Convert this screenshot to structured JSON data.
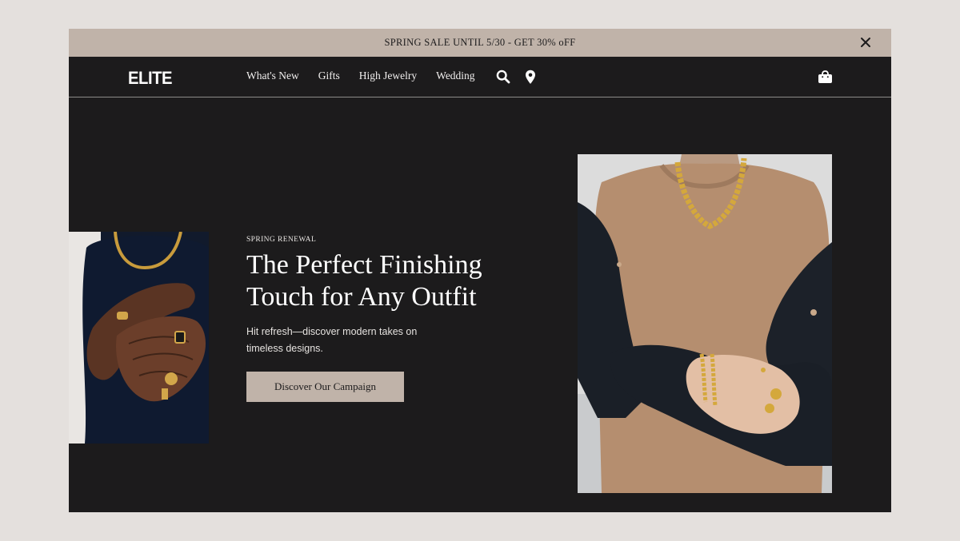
{
  "promo": {
    "text": "SPRING SALE UNTIL 5/30 - GET 30% oFF",
    "close_icon": "close-icon"
  },
  "nav": {
    "logo": "ELITE",
    "links": [
      "What's New",
      "Gifts",
      "High Jewelry",
      "Wedding"
    ],
    "icons": [
      "search-icon",
      "location-pin-icon",
      "shopping-bag-icon"
    ]
  },
  "hero": {
    "eyebrow": "SPRING RENEWAL",
    "headline": "The Perfect Finishing Touch for Any Outfit",
    "subtext": "Hit refresh—discover modern takes on timeless designs.",
    "cta_label": "Discover Our Campaign"
  },
  "colors": {
    "background": "#e4e0dd",
    "surface": "#1c1b1c",
    "accent": "#c0b3a9",
    "text_light": "#ffffff"
  }
}
